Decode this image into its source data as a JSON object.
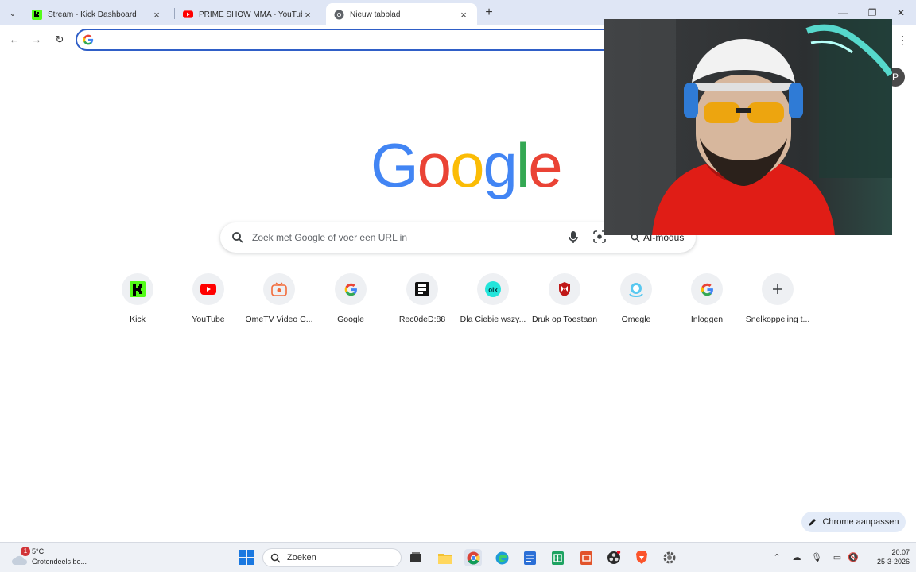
{
  "browser": {
    "tabs": [
      {
        "title": "Stream - Kick Dashboard",
        "favicon": "kick-favicon",
        "active": false
      },
      {
        "title": "PRIME SHOW MMA - YouTube",
        "favicon": "youtube-favicon",
        "active": false
      },
      {
        "title": "Nieuw tabblad",
        "favicon": "chrome-favicon",
        "active": true
      }
    ],
    "omnibox_value": "",
    "profile_initial": "P"
  },
  "newtab": {
    "logo_letters": [
      "G",
      "o",
      "o",
      "g",
      "l",
      "e"
    ],
    "search_placeholder": "Zoek met Google of voer een URL in",
    "ai_mode_label": "AI-modus",
    "shortcuts": [
      {
        "label": "Kick",
        "icon": "kick-icon"
      },
      {
        "label": "YouTube",
        "icon": "youtube-icon"
      },
      {
        "label": "OmeTV Video C...",
        "icon": "ometv-icon"
      },
      {
        "label": "Google",
        "icon": "google-icon"
      },
      {
        "label": "Rec0deD:88",
        "icon": "recoded-icon"
      },
      {
        "label": "Dla Ciebie wszy...",
        "icon": "olx-icon"
      },
      {
        "label": "Druk op Toestaan",
        "icon": "shield-icon"
      },
      {
        "label": "Omegle",
        "icon": "omegle-icon"
      },
      {
        "label": "Inloggen",
        "icon": "google-icon"
      },
      {
        "label": "Snelkoppeling t...",
        "icon": "plus-icon"
      }
    ],
    "customize_label": "Chrome aanpassen"
  },
  "taskbar": {
    "weather_badge": "1",
    "weather_temp": "5°C",
    "weather_desc": "Grotendeels be...",
    "search_label": "Zoeken",
    "time": "20:07",
    "date": "25-3-2026"
  },
  "colors": {
    "tabstrip": "#dfe6f5",
    "omnibox_border": "#2f5ec7",
    "kick_green": "#53fc18",
    "youtube_red": "#ff0000"
  }
}
